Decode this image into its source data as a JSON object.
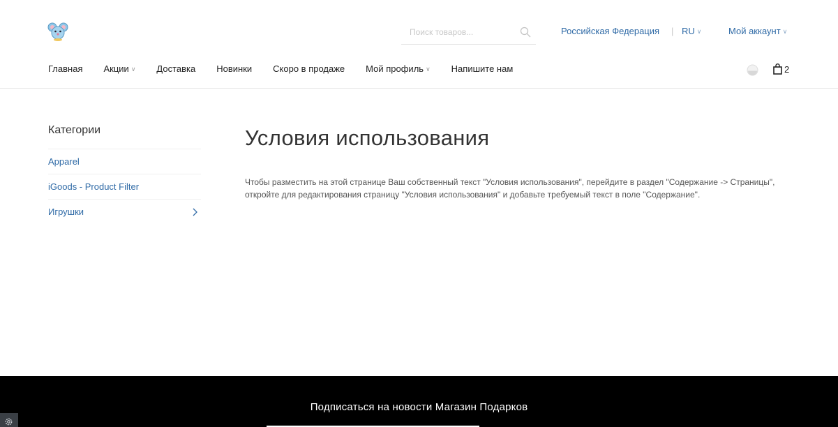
{
  "header": {
    "search": {
      "placeholder": "Поиск товаров...",
      "value": ""
    },
    "country": "Российская Федерация",
    "separator": "|",
    "language": "RU",
    "account": "Мой аккаунт",
    "cart_count": "2"
  },
  "nav": {
    "items": [
      {
        "label": "Главная"
      },
      {
        "label": "Акции"
      },
      {
        "label": "Доставка"
      },
      {
        "label": "Новинки"
      },
      {
        "label": "Скоро в продаже"
      },
      {
        "label": "Мой профиль"
      },
      {
        "label": "Напишите нам"
      }
    ]
  },
  "sidebar": {
    "title": "Категории",
    "items": [
      {
        "label": "Apparel"
      },
      {
        "label": "iGoods - Product Filter"
      },
      {
        "label": "Игрушки"
      }
    ]
  },
  "main": {
    "title": "Условия использования",
    "text": "Чтобы разместить на этой странице Ваш собственный текст \"Условия использования\", перейдите в раздел \"Содержание -> Страницы\", откройте для редактирования страницу \"Условия использования\" и добавьте требуемый текст в поле \"Содержание\"."
  },
  "footer": {
    "subscribe_title": "Подписаться на новости Магазин Подарков"
  },
  "colors": {
    "link": "#2f6aa6",
    "footer_bg": "#000000"
  },
  "icons": {
    "logo": "mouse-logo-icon",
    "search": "search-icon",
    "compare": "compare-icon",
    "cart": "shopping-bag-icon",
    "settings": "gear-icon"
  }
}
